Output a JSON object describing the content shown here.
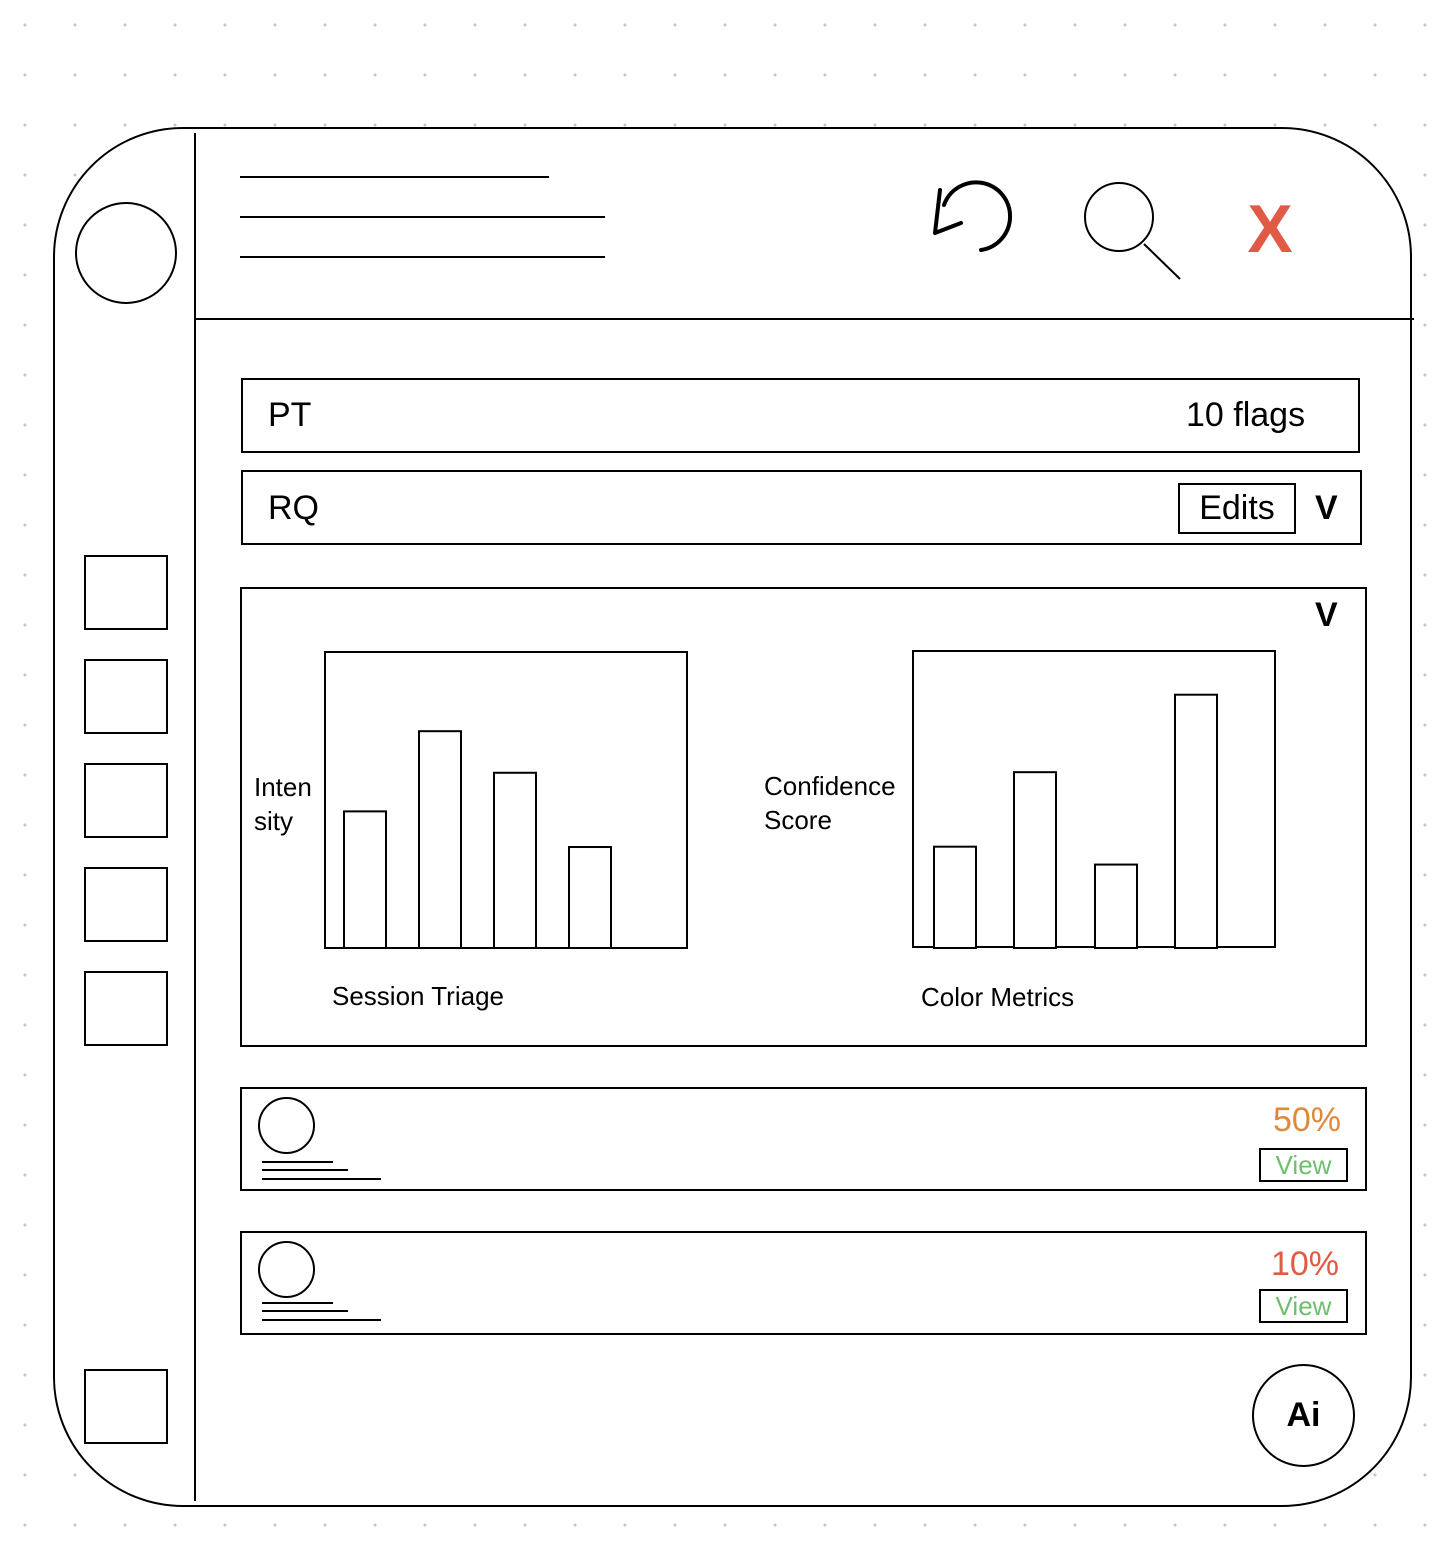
{
  "header": {
    "refresh_icon": "refresh-icon",
    "search_icon": "search-icon",
    "close_label": "X",
    "close_color": "#e05a45"
  },
  "rows": {
    "pt": {
      "label": "PT",
      "flags": "10 flags"
    },
    "rq": {
      "label": "RQ",
      "edits_label": "Edits",
      "chevron": "V"
    }
  },
  "charts_panel": {
    "chevron": "V",
    "charts": [
      {
        "ylabel_line1": "Inten",
        "ylabel_line2": "sity",
        "caption": "Session Triage"
      },
      {
        "ylabel_line1": "Confidence",
        "ylabel_line2": "Score",
        "caption": "Color Metrics"
      }
    ]
  },
  "chart_data": [
    {
      "type": "bar",
      "title": "",
      "xlabel": "Session Triage",
      "ylabel": "Intensity",
      "categories": [
        "",
        "",
        "",
        ""
      ],
      "values": [
        46,
        73,
        59,
        34
      ],
      "ylim": [
        0,
        100
      ]
    },
    {
      "type": "bar",
      "title": "",
      "xlabel": "Color Metrics",
      "ylabel": "Confidence Score",
      "categories": [
        "",
        "",
        "",
        ""
      ],
      "values": [
        34,
        59,
        28,
        85
      ],
      "ylim": [
        0,
        100
      ]
    }
  ],
  "items": [
    {
      "percent": "50%",
      "percent_color": "#e0893a",
      "view_label": "View"
    },
    {
      "percent": "10%",
      "percent_color": "#e05a45",
      "view_label": "View"
    }
  ],
  "ai_button": {
    "label": "Ai"
  },
  "view_color": "#6dbf6d"
}
